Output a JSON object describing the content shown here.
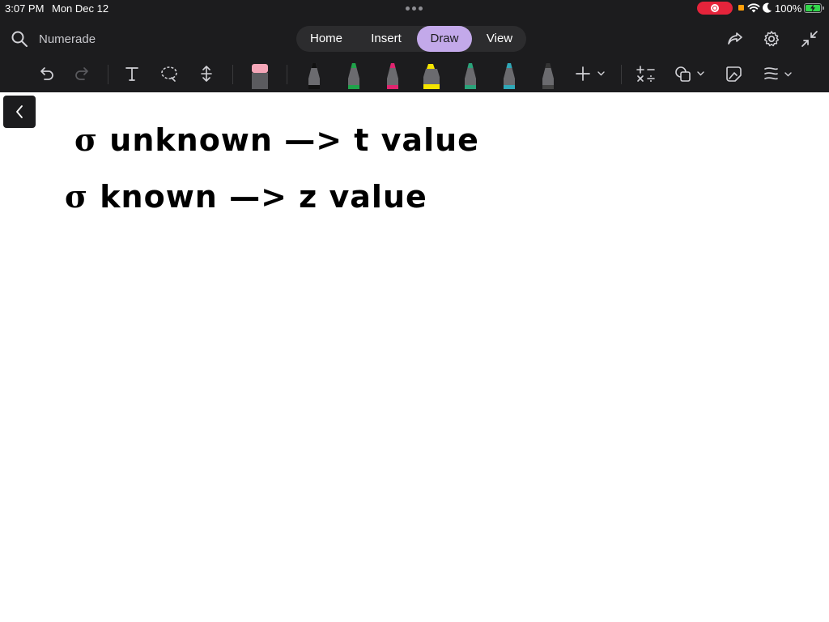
{
  "status_bar": {
    "time": "3:07 PM",
    "date": "Mon Dec 12",
    "battery": "100%",
    "record_color": "#e5243b",
    "battery_color": "#32d74b"
  },
  "app_bar": {
    "title": "Numerade",
    "tabs": [
      {
        "label": "Home",
        "active": false
      },
      {
        "label": "Insert",
        "active": false
      },
      {
        "label": "Draw",
        "active": true
      },
      {
        "label": "View",
        "active": false
      }
    ],
    "accent_color": "#c3a9ea"
  },
  "toolbar": {
    "tools": [
      "undo-icon",
      "redo-icon",
      "text-tool-icon",
      "lasso-icon",
      "add-space-icon",
      "eraser-icon"
    ],
    "pens": [
      {
        "name": "black-pen",
        "color": "#111111"
      },
      {
        "name": "green-pen",
        "color": "#1fa34a"
      },
      {
        "name": "pink-pen",
        "color": "#e0246f"
      },
      {
        "name": "yellow-highlighter",
        "color": "#f5e400"
      },
      {
        "name": "teal-pen",
        "color": "#2aa37a"
      },
      {
        "name": "cyan-pen",
        "color": "#2fa8b8"
      },
      {
        "name": "gray-pen",
        "color": "#555555"
      }
    ],
    "extras": [
      "add-pen-icon",
      "math-icon",
      "shapes-icon",
      "ink-to-shape-icon",
      "ruler-icon"
    ]
  },
  "canvas": {
    "lines": [
      {
        "symbol": "σ",
        "text": "unknown —> t value"
      },
      {
        "symbol": "σ",
        "text": "known —> z value"
      }
    ]
  }
}
